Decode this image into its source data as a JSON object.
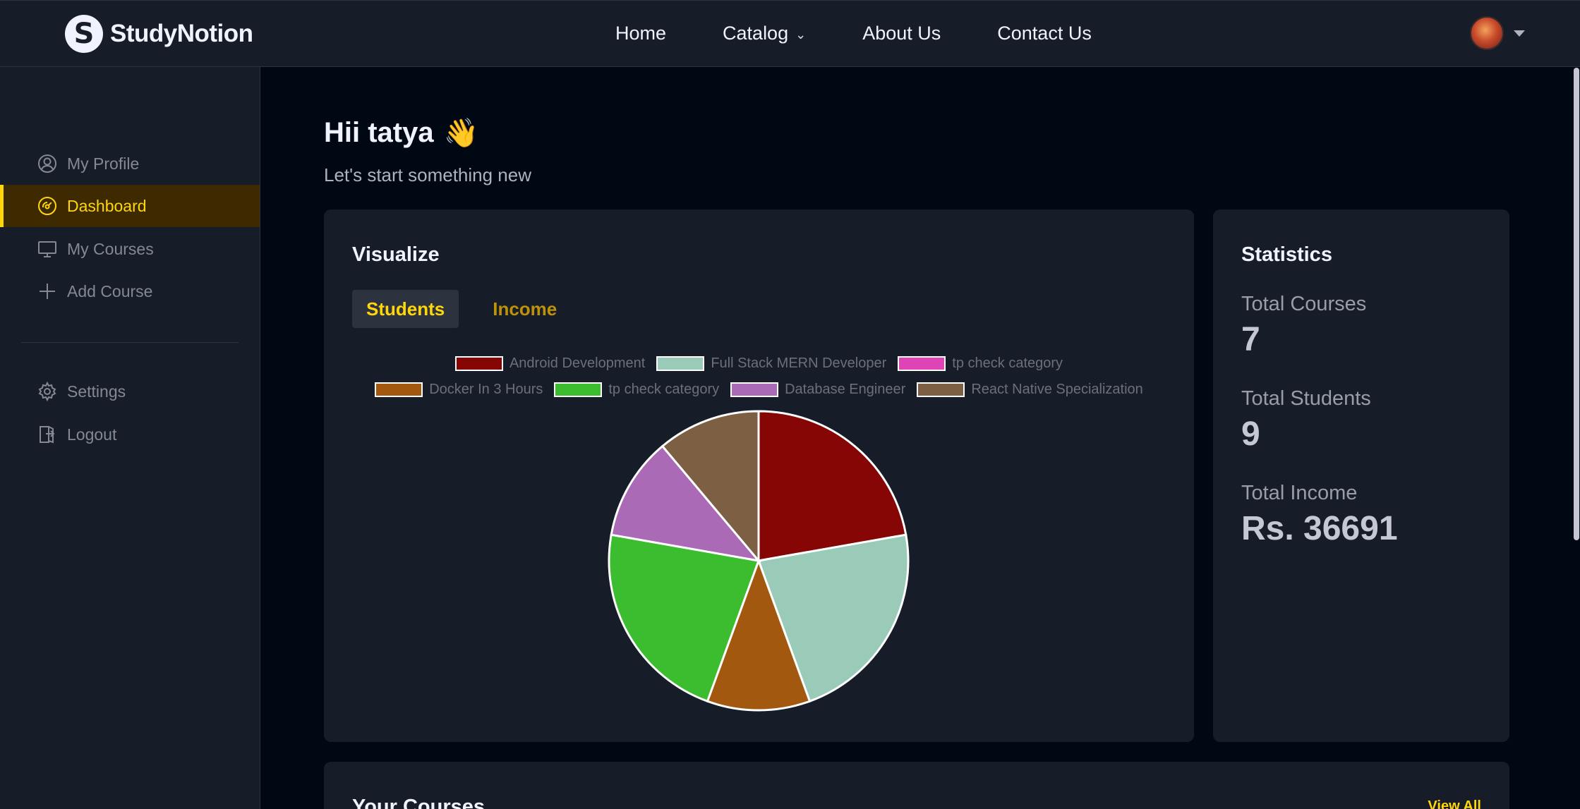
{
  "navbar": {
    "logo_mark": "S",
    "logo_text": "StudyNotion",
    "links": [
      "Home",
      "Catalog",
      "About Us",
      "Contact Us"
    ]
  },
  "sidebar": {
    "items": [
      {
        "label": "My Profile",
        "icon": "user-circle-icon"
      },
      {
        "label": "Dashboard",
        "icon": "gauge-icon"
      },
      {
        "label": "My Courses",
        "icon": "monitor-icon"
      },
      {
        "label": "Add Course",
        "icon": "plus-icon"
      },
      {
        "label": "Settings",
        "icon": "gear-icon"
      },
      {
        "label": "Logout",
        "icon": "logout-icon"
      }
    ],
    "active_item": "Dashboard"
  },
  "main": {
    "greeting": "Hii tatya",
    "greeting_emoji": "👋",
    "subtitle": "Let's start something new"
  },
  "visualize": {
    "title": "Visualize",
    "tabs": [
      "Students",
      "Income"
    ],
    "active_tab": "Students"
  },
  "statistics": {
    "title": "Statistics",
    "total_courses_label": "Total Courses",
    "total_courses": "7",
    "total_students_label": "Total Students",
    "total_students": "9",
    "total_income_label": "Total Income",
    "total_income": "Rs. 36691"
  },
  "courses": {
    "title": "Your Courses",
    "view_all": "View All"
  },
  "colors": {
    "accent": "#FFD60A",
    "active_bg": "#3D2A01",
    "card_bg": "#161D29",
    "page_bg": "#000814"
  },
  "chart_data": {
    "type": "pie",
    "legend_position": "top",
    "categories": [
      "Android Development",
      "Full Stack MERN Developer",
      "tp check category",
      "Docker In 3 Hours",
      "tp check category",
      "Database Engineer",
      "React Native Specialization"
    ],
    "values": [
      2,
      2,
      0,
      1,
      2,
      1,
      1
    ],
    "colors": [
      "#850605",
      "#9ACBB8",
      "#DE44B5",
      "#A35810",
      "#3CBD30",
      "#AA6AB5",
      "#7D5F43"
    ]
  }
}
